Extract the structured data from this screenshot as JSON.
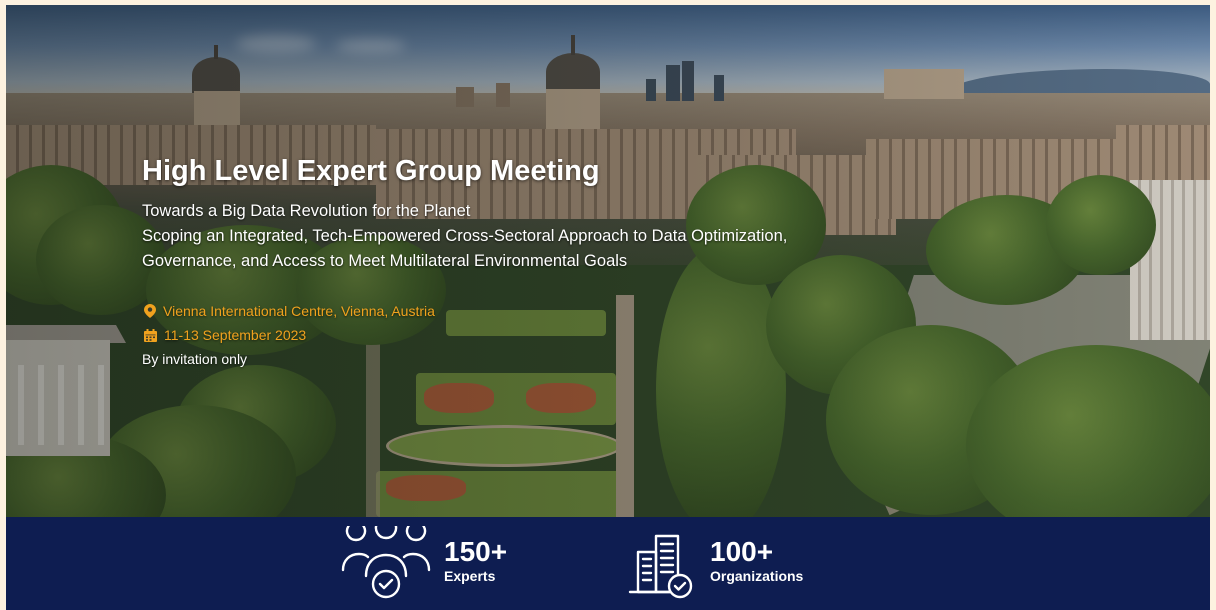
{
  "hero": {
    "title": "High Level Expert Group Meeting",
    "subtitle_lines": [
      "Towards a Big Data Revolution for the Planet",
      "Scoping an Integrated, Tech-Empowered Cross-Sectoral Approach to Data Optimization,",
      "Governance, and Access to Meet Multilateral Environmental Goals"
    ],
    "location": "Vienna International Centre, Vienna, Austria",
    "dates": "11-13 September 2023",
    "note": "By invitation only"
  },
  "stats": [
    {
      "value": "150+",
      "label": "Experts",
      "icon": "people-check-icon"
    },
    {
      "value": "100+",
      "label": "Organizations",
      "icon": "buildings-check-icon"
    }
  ],
  "colors": {
    "accent": "#f0a21e",
    "band": "#0e1d51",
    "text": "#ffffff"
  }
}
